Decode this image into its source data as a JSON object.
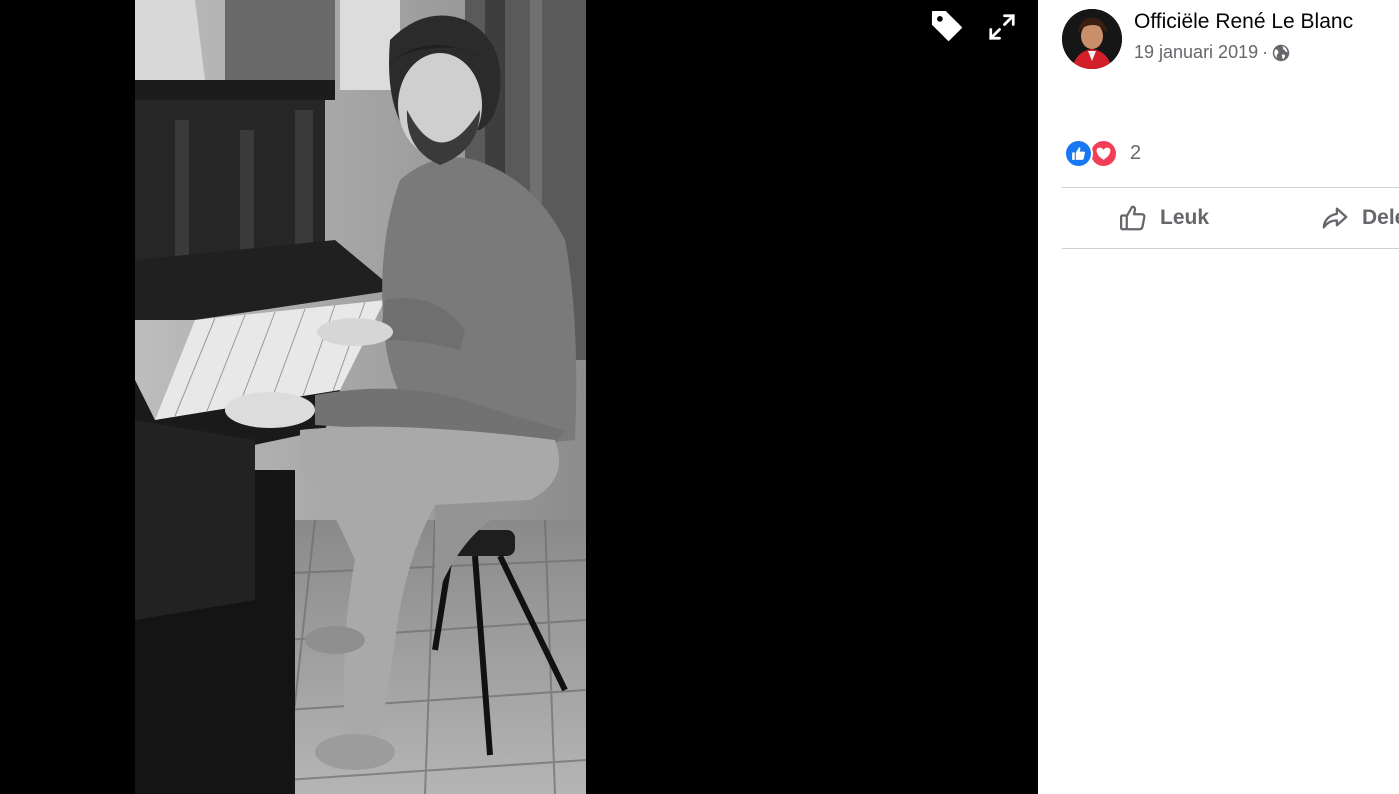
{
  "viewer": {
    "photo_alt": "",
    "buttons": [
      {
        "name": "tag",
        "icon": "tag-icon"
      },
      {
        "name": "fullscreen",
        "icon": "expand-icon"
      }
    ]
  },
  "post": {
    "author": "Officiële René Le Blanc",
    "date": "19 januari 2019",
    "separator": "·",
    "privacy_icon": "globe-icon"
  },
  "reactions": {
    "icons": [
      "like-icon",
      "love-icon"
    ],
    "count": "2"
  },
  "actions": {
    "like_label": "Leuk",
    "share_label": "Delen"
  },
  "colors": {
    "text_primary": "#050505",
    "text_secondary": "#65676b",
    "like_blue": "#1877f2",
    "love_red": "#f33e58",
    "divider": "#ced0d4"
  }
}
